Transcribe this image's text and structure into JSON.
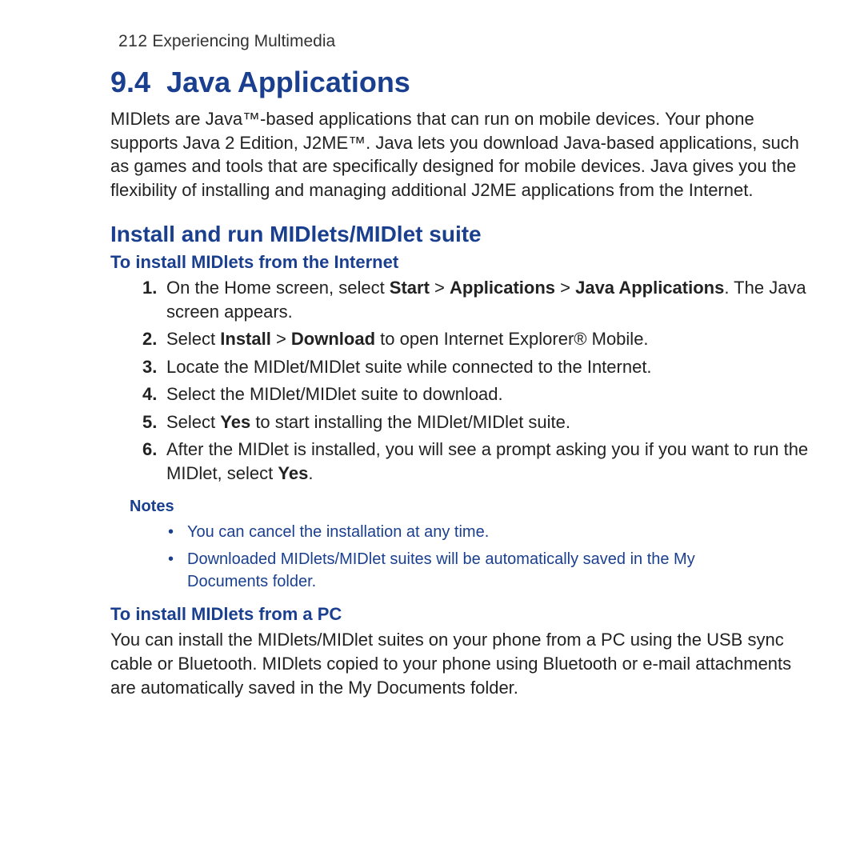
{
  "header": {
    "page_number": "212",
    "chapter_title": "Experiencing Multimedia"
  },
  "section": {
    "number": "9.4",
    "title": "Java Applications",
    "intro": "MIDlets are Java™-based applications that can run on mobile devices. Your phone supports Java 2 Edition, J2ME™. Java lets you download Java-based applications, such as games and tools that are specifically designed for mobile devices. Java gives you the flexibility of installing and managing additional J2ME applications from the Internet."
  },
  "subsection": {
    "title": "Install and run MIDlets/MIDlet suite"
  },
  "internet": {
    "heading": "To install MIDlets from the Internet",
    "steps": [
      {
        "n": "1.",
        "pre": "On the Home screen, select ",
        "b1": "Start",
        "mid1": " > ",
        "b2": "Applications",
        "mid2": " > ",
        "b3": "Java Applications",
        "post": ". The Java screen appears."
      },
      {
        "n": "2.",
        "pre": "Select ",
        "b1": "Install",
        "mid1": " > ",
        "b2": "Download",
        "mid2": " to open Internet Explorer® Mobile.",
        "b3": "",
        "post": ""
      },
      {
        "n": "3.",
        "pre": "Locate the MIDlet/MIDlet suite while connected to the Internet.",
        "b1": "",
        "mid1": "",
        "b2": "",
        "mid2": "",
        "b3": "",
        "post": ""
      },
      {
        "n": "4.",
        "pre": "Select the MIDlet/MIDlet suite to download.",
        "b1": "",
        "mid1": "",
        "b2": "",
        "mid2": "",
        "b3": "",
        "post": ""
      },
      {
        "n": "5.",
        "pre": "Select ",
        "b1": "Yes",
        "mid1": " to start installing the MIDlet/MIDlet suite.",
        "b2": "",
        "mid2": "",
        "b3": "",
        "post": ""
      },
      {
        "n": "6.",
        "pre": "After the MIDlet is installed, you will see a prompt asking you if you want to run the MIDlet, select ",
        "b1": "Yes",
        "mid1": ".",
        "b2": "",
        "mid2": "",
        "b3": "",
        "post": ""
      }
    ]
  },
  "notes": {
    "label": "Notes",
    "items": [
      "You can cancel the installation at any time.",
      "Downloaded MIDlets/MIDlet suites will be automatically saved in the My Documents folder."
    ]
  },
  "pc": {
    "heading": "To install MIDlets from a PC",
    "para": "You can install the MIDlets/MIDlet suites on your phone from a PC using the USB sync cable or Bluetooth. MIDlets copied to your phone using Bluetooth or e-mail attachments are automatically saved in the My Documents folder."
  }
}
